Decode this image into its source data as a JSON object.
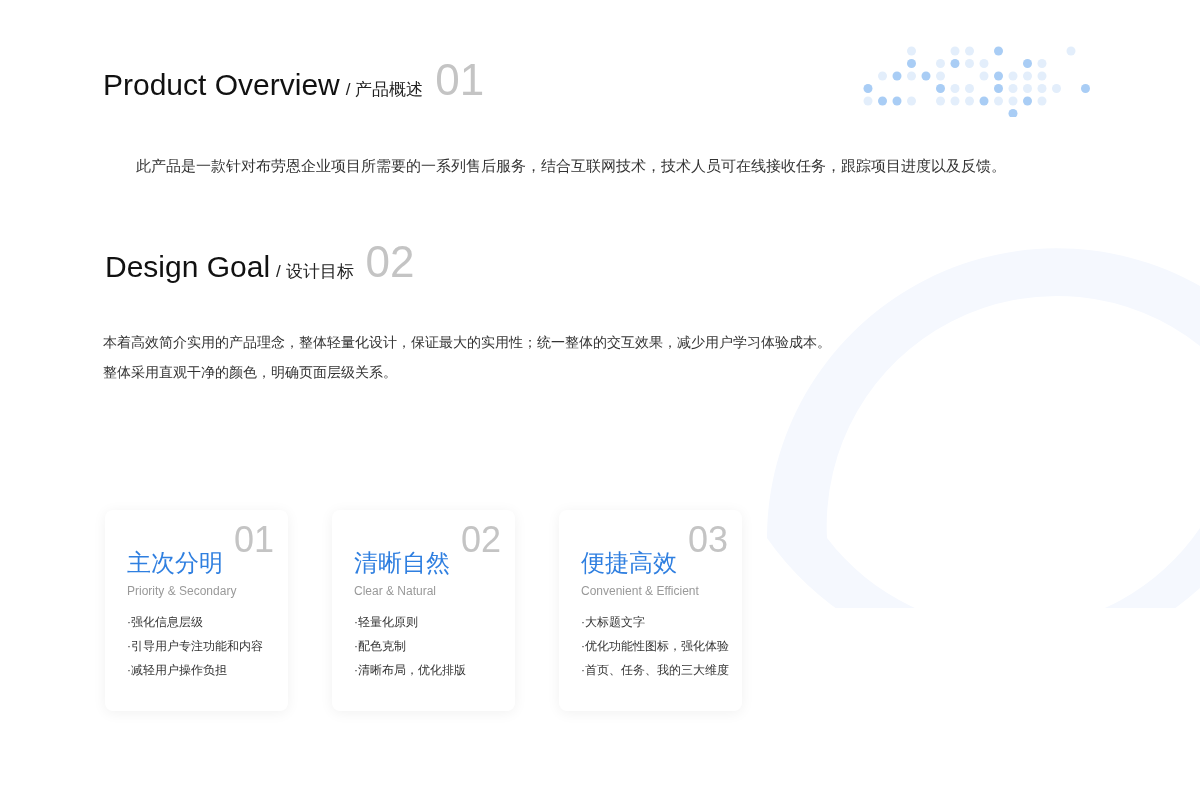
{
  "sections": [
    {
      "title": "Product Overview",
      "subtitle": "/ 产品概述",
      "number": "01",
      "paragraphs": [
        "此产品是一款针对布劳恩企业项目所需要的一系列售后服务，结合互联网技术，技术人员可在线接收任务，跟踪项目进度以及反馈。"
      ]
    },
    {
      "title": "Design Goal",
      "subtitle": "/ 设计目标",
      "number": "02",
      "paragraphs": [
        "本着高效简介实用的产品理念，整体轻量化设计，保证最大的实用性；统一整体的交互效果，减少用户学习体验成本。",
        "整体采用直观干净的颜色，明确页面层级关系。"
      ]
    }
  ],
  "cards": [
    {
      "number": "01",
      "title": "主次分明",
      "subtitle": "Priority & Secondary",
      "bullets": [
        "·强化信息层级",
        "·引导用户专注功能和内容",
        "·减轻用户操作负担"
      ]
    },
    {
      "number": "02",
      "title": "清晰自然",
      "subtitle": "Clear & Natural",
      "bullets": [
        "·轻量化原则",
        "·配色克制",
        "·清晰布局，优化排版"
      ]
    },
    {
      "number": "03",
      "title": "便捷高效",
      "subtitle": "Convenient & Efficient",
      "bullets": [
        "·大标题文字",
        "·优化功能性图标，强化体验",
        "·首页、任务、我的三大维度"
      ]
    }
  ]
}
